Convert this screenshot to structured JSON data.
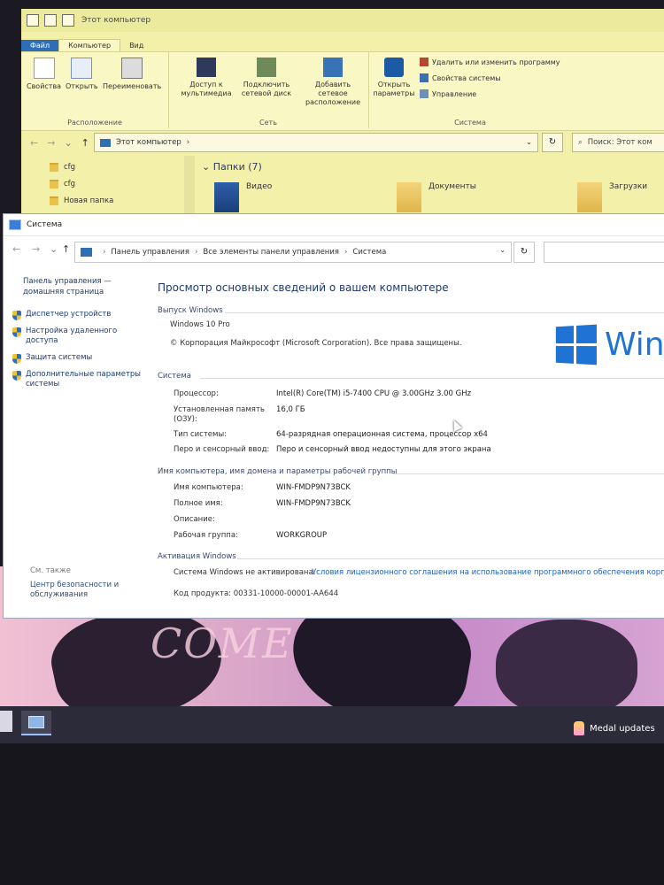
{
  "explorer": {
    "title": "Этот компьютер",
    "tabs": [
      "Файл",
      "Компьютер",
      "Вид"
    ],
    "ribbon": {
      "properties": "Свойства",
      "open": "Открыть",
      "rename": "Переименовать",
      "group_location": "Расположение",
      "media_access": "Доступ к мультимедиа",
      "map_drive": "Подключить сетевой диск",
      "add_location": "Добавить сетевое расположение",
      "group_network": "Сеть",
      "open_settings": "Открыть параметры",
      "uninstall": "Удалить или изменить программу",
      "system_props": "Свойства системы",
      "manage": "Управление",
      "group_system": "Система"
    },
    "address": "Этот компьютер",
    "search_placeholder": "Поиск: Этот ком",
    "nav_items": [
      "cfg",
      "cfg",
      "Новая папка"
    ],
    "folders_header": "Папки (7)",
    "folders": [
      "Видео",
      "Документы",
      "Загрузки"
    ]
  },
  "system": {
    "title": "Система",
    "breadcrumb": [
      "Панель управления",
      "Все элементы панели управления",
      "Система"
    ],
    "left_panel": {
      "home": "Панель управления — домашняя страница",
      "items": [
        "Диспетчер устройств",
        "Настройка удаленного доступа",
        "Защита системы",
        "Дополнительные параметры системы"
      ],
      "see_also": "См. также",
      "security_center": "Центр безопасности и обслуживания"
    },
    "heading": "Просмотр основных сведений о вашем компьютере",
    "edition_section": "Выпуск Windows",
    "edition": "Windows 10 Pro",
    "copyright": "© Корпорация Майкрософт (Microsoft Corporation). Все права защищены.",
    "logo_text": "Win",
    "system_section": "Система",
    "rows": {
      "processor_label": "Процессор:",
      "processor_value": "Intel(R) Core(TM) i5-7400 CPU @ 3.00GHz   3.00 GHz",
      "ram_label": "Установленная память (ОЗУ):",
      "ram_value": "16,0 ГБ",
      "type_label": "Тип системы:",
      "type_value": "64-разрядная операционная система, процессор x64",
      "pen_label": "Перо и сенсорный ввод:",
      "pen_value": "Перо и сенсорный ввод недоступны для этого экрана"
    },
    "name_section": "Имя компьютера, имя домена и параметры рабочей группы",
    "name_rows": {
      "computer_label": "Имя компьютера:",
      "computer_value": "WIN-FMDP9N73BCK",
      "full_label": "Полное имя:",
      "full_value": "WIN-FMDP9N73BCK",
      "desc_label": "Описание:",
      "workgroup_label": "Рабочая группа:",
      "workgroup_value": "WORKGROUP"
    },
    "activation_section": "Активация Windows",
    "activation_status": "Система Windows не активирована.",
    "license_link": "Условия лицензионного соглашения на использование программного обеспечения корпор",
    "product_code": "Код продукта:  00331-10000-00001-AA644"
  },
  "wallpaper_text": "COME",
  "taskbar": {
    "notification": "Medal updates"
  }
}
